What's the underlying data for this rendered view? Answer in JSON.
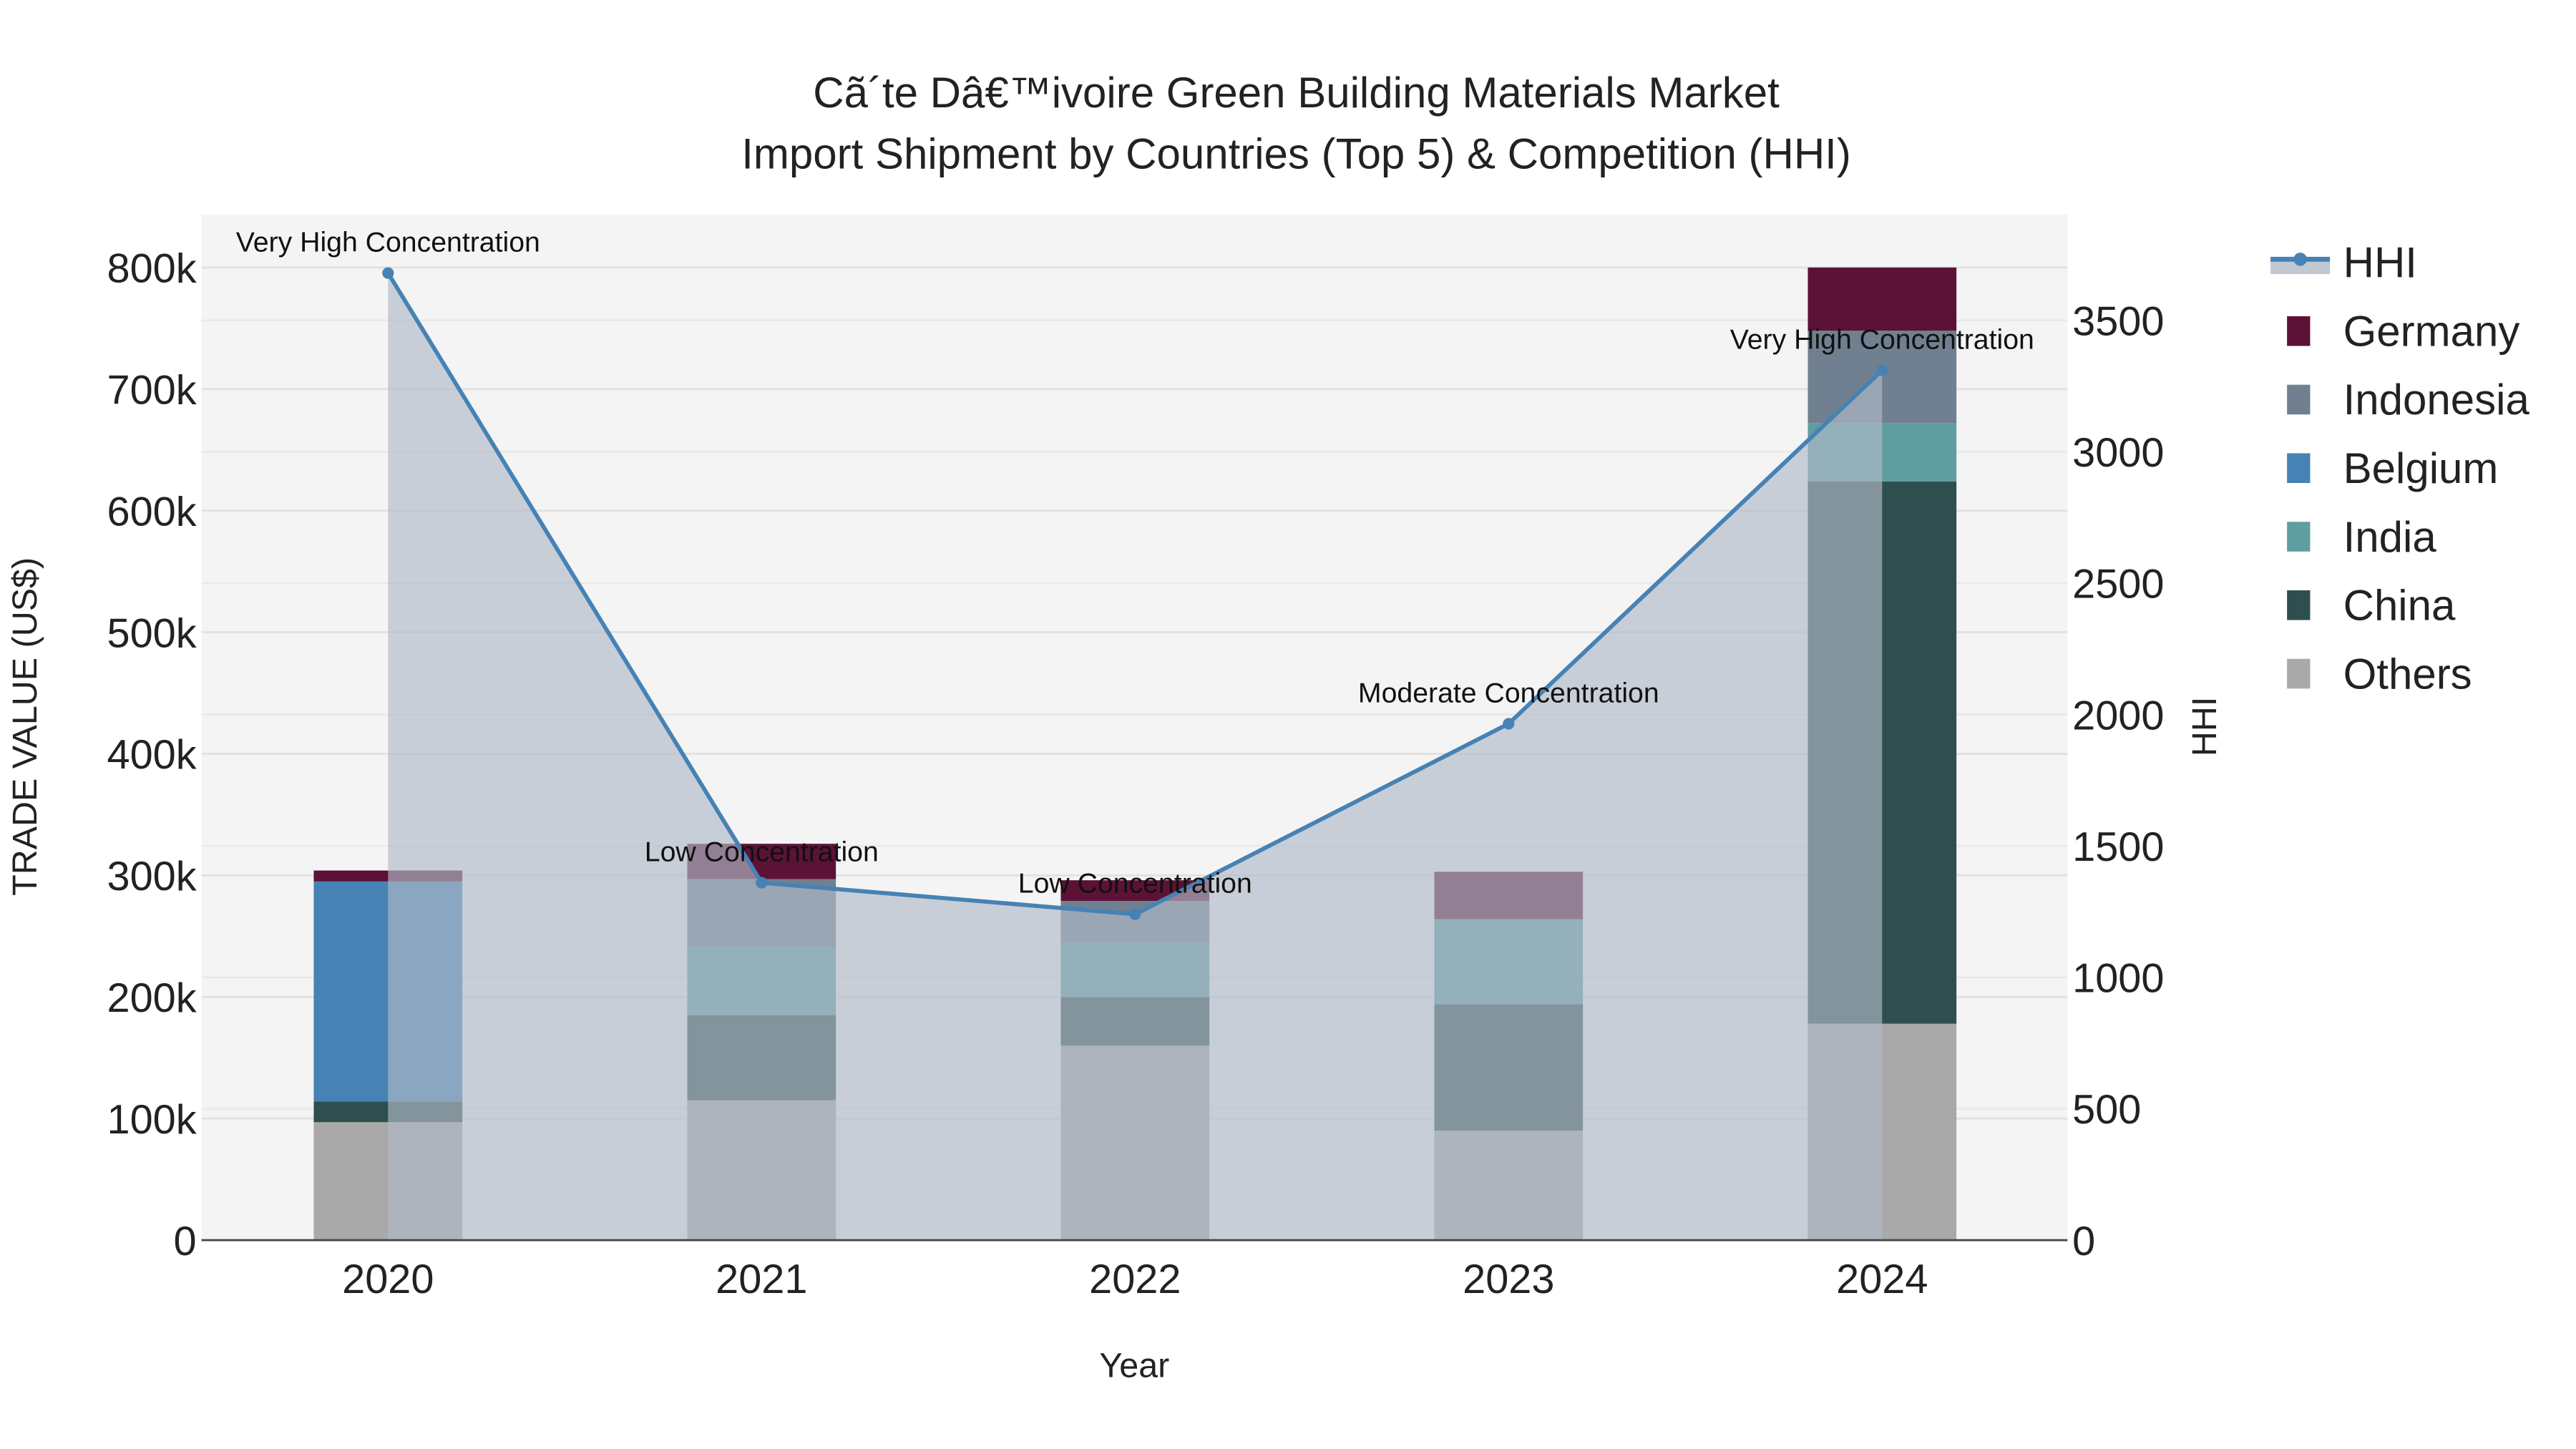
{
  "chart_data": {
    "type": "bar",
    "title_line1": "Cã´te Dâ€™ivoire Green Building Materials Market",
    "title_line2": "Import Shipment by Countries (Top 5) & Competition (HHI)",
    "xlabel": "Year",
    "ylabel": "TRADE VALUE (US$)",
    "y2label": "HHI",
    "categories": [
      "2020",
      "2021",
      "2022",
      "2023",
      "2024"
    ],
    "ylim": [
      0,
      840000
    ],
    "y2lim": [
      0,
      3900
    ],
    "yticks": [
      0,
      100000,
      200000,
      300000,
      400000,
      500000,
      600000,
      700000,
      800000
    ],
    "ytick_labels": [
      "0",
      "100k",
      "200k",
      "300k",
      "400k",
      "500k",
      "600k",
      "700k",
      "800k"
    ],
    "y2ticks": [
      0,
      500,
      1000,
      1500,
      2000,
      2500,
      3000,
      3500
    ],
    "y2tick_labels": [
      "0",
      "500",
      "1000",
      "1500",
      "2000",
      "2500",
      "3000",
      "3500"
    ],
    "stacked": true,
    "series": [
      {
        "name": "Others",
        "color": "#a9a9a9",
        "values": [
          97000,
          115000,
          160000,
          90000,
          178000
        ]
      },
      {
        "name": "China",
        "color": "#2f4f4f",
        "values": [
          17000,
          70000,
          40000,
          104000,
          446000
        ]
      },
      {
        "name": "India",
        "color": "#5f9ea0",
        "values": [
          0,
          56000,
          45000,
          70000,
          48000
        ]
      },
      {
        "name": "Belgium",
        "color": "#4682b4",
        "values": [
          181000,
          0,
          0,
          0,
          0
        ]
      },
      {
        "name": "Indonesia",
        "color": "#708090",
        "values": [
          0,
          56000,
          34000,
          0,
          76000
        ]
      },
      {
        "name": "Germany",
        "color": "#5c1236",
        "values": [
          9000,
          29000,
          17000,
          39000,
          52000
        ]
      }
    ],
    "hhi": {
      "name": "HHI",
      "color": "#4682b4",
      "values": [
        3680,
        1360,
        1240,
        1965,
        3310
      ],
      "annotations": [
        "Very High Concentration",
        "Low Concentration",
        "Low Concentration",
        "Moderate Concentration",
        "Very High Concentration"
      ]
    },
    "legend": [
      "HHI",
      "Germany",
      "Indonesia",
      "Belgium",
      "India",
      "China",
      "Others"
    ],
    "legend_position": "right",
    "grid": true
  }
}
